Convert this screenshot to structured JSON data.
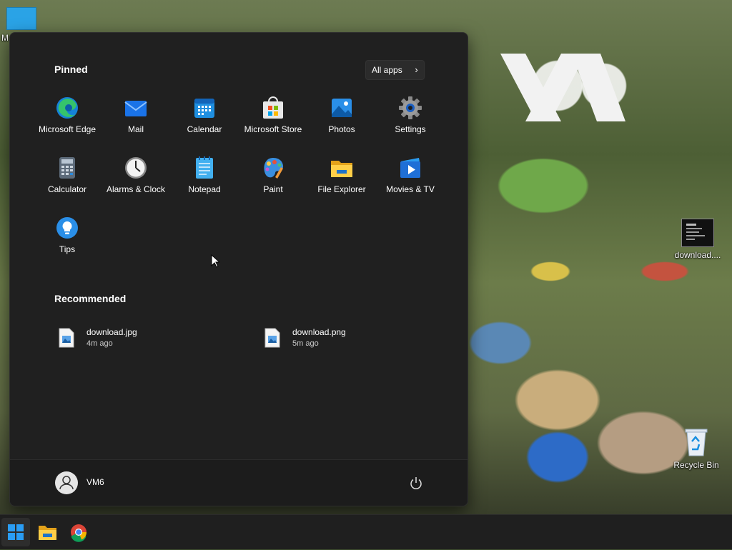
{
  "desktop": {
    "icons": [
      {
        "label": "M"
      },
      {
        "label": "download...."
      },
      {
        "label": "Recycle Bin"
      }
    ]
  },
  "start_menu": {
    "pinned_title": "Pinned",
    "all_apps_label": "All apps",
    "pinned_apps": [
      {
        "label": "Microsoft Edge",
        "icon": "edge-icon"
      },
      {
        "label": "Mail",
        "icon": "mail-icon"
      },
      {
        "label": "Calendar",
        "icon": "calendar-icon"
      },
      {
        "label": "Microsoft Store",
        "icon": "store-icon"
      },
      {
        "label": "Photos",
        "icon": "photos-icon"
      },
      {
        "label": "Settings",
        "icon": "gear-icon"
      },
      {
        "label": "Calculator",
        "icon": "calculator-icon"
      },
      {
        "label": "Alarms & Clock",
        "icon": "clock-icon"
      },
      {
        "label": "Notepad",
        "icon": "notepad-icon"
      },
      {
        "label": "Paint",
        "icon": "paint-icon"
      },
      {
        "label": "File Explorer",
        "icon": "folder-icon"
      },
      {
        "label": "Movies & TV",
        "icon": "movies-icon"
      },
      {
        "label": "Tips",
        "icon": "tips-icon"
      }
    ],
    "recommended_title": "Recommended",
    "recommended": [
      {
        "name": "download.jpg",
        "time": "4m ago"
      },
      {
        "name": "download.png",
        "time": "5m ago"
      }
    ],
    "user": {
      "name": "VM6"
    }
  },
  "taskbar": {
    "items": [
      {
        "icon": "windows-start-icon",
        "active": true
      },
      {
        "icon": "folder-icon",
        "active": false
      },
      {
        "icon": "chrome-icon",
        "active": false
      }
    ]
  },
  "colors": {
    "menu_bg": "#202020",
    "taskbar_bg": "#1f1f1f",
    "accent": "#0078d4"
  }
}
